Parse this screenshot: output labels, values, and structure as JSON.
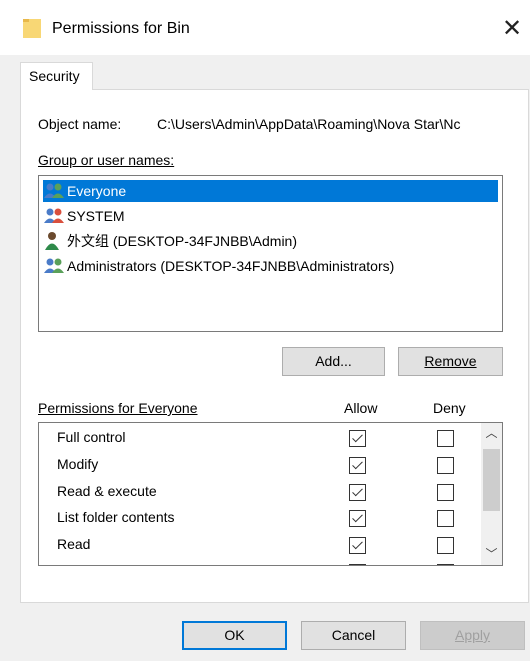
{
  "window": {
    "title": "Permissions for Bin",
    "close_glyph": "✕"
  },
  "tabs": [
    {
      "label": "Security",
      "active": true
    }
  ],
  "object": {
    "label": "Object name:",
    "value": "C:\\Users\\Admin\\AppData\\Roaming\\Nova Star\\Nc"
  },
  "users": {
    "label": "Group or user names:",
    "items": [
      {
        "name": "Everyone",
        "icon": "users-group-icon",
        "selected": true
      },
      {
        "name": "SYSTEM",
        "icon": "users-group-icon",
        "selected": false
      },
      {
        "name": "外文组 (DESKTOP-34FJNBB\\Admin)",
        "icon": "user-icon",
        "selected": false
      },
      {
        "name": "Administrators (DESKTOP-34FJNBB\\Administrators)",
        "icon": "users-group-icon",
        "selected": false
      }
    ],
    "add_label": "Add...",
    "remove_label": "Remove"
  },
  "permissions": {
    "label": "Permissions for Everyone",
    "allow_label": "Allow",
    "deny_label": "Deny",
    "rows": [
      {
        "name": "Full control",
        "allow": true,
        "deny": false
      },
      {
        "name": "Modify",
        "allow": true,
        "deny": false
      },
      {
        "name": "Read & execute",
        "allow": true,
        "deny": false
      },
      {
        "name": "List folder contents",
        "allow": true,
        "deny": false
      },
      {
        "name": "Read",
        "allow": true,
        "deny": false
      }
    ]
  },
  "footer": {
    "ok_label": "OK",
    "cancel_label": "Cancel",
    "apply_label": "Apply"
  },
  "colors": {
    "selection": "#0078d7",
    "dialog_bg": "#f0f0f0",
    "panel_bg": "#ffffff"
  }
}
